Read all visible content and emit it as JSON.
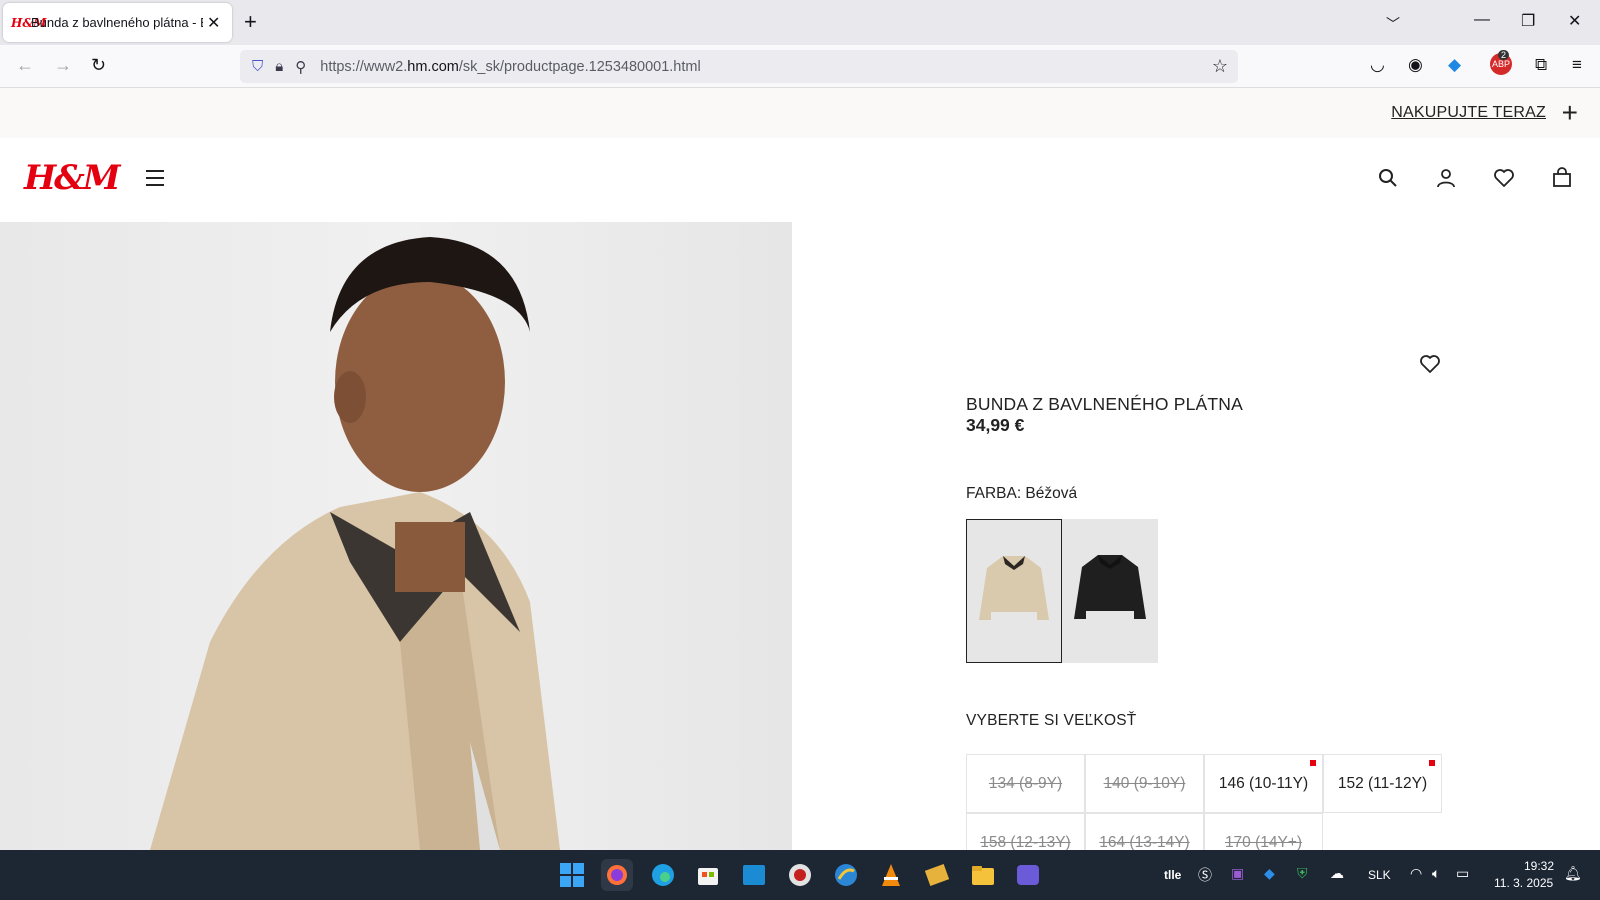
{
  "browser": {
    "tab_title": "Bunda z bavlneného plátna - Be",
    "tab_favicon": "H&M",
    "url_prefix": "https://www2.",
    "url_domain": "hm.com",
    "url_path": "/sk_sk/productpage.1253480001.html",
    "extension_count": "2"
  },
  "promo": {
    "link_label": "NAKUPUJTE TERAZ"
  },
  "header": {
    "logo": "H&M"
  },
  "product": {
    "title": "BUNDA Z BAVLNENÉHO PLÁTNA",
    "price": "34,99 €",
    "color_label": "FARBA: Béžová",
    "swatches": [
      {
        "name": "beige",
        "color": "#d9c9ad",
        "collar": "#2b2622"
      },
      {
        "name": "black",
        "color": "#1f1f1f",
        "collar": "#121212"
      }
    ],
    "size_label": "VYBERTE SI VEĽKOSŤ",
    "sizes": [
      {
        "label": "134 (8-9Y)",
        "available": false,
        "low_stock": false
      },
      {
        "label": "140 (9-10Y)",
        "available": false,
        "low_stock": false
      },
      {
        "label": "146 (10-11Y)",
        "available": true,
        "low_stock": true
      },
      {
        "label": "152 (11-12Y)",
        "available": true,
        "low_stock": true
      },
      {
        "label": "158 (12-13Y)",
        "available": false,
        "low_stock": false
      },
      {
        "label": "164 (13-14Y)",
        "available": false,
        "low_stock": false
      },
      {
        "label": "170 (14Y+)",
        "available": false,
        "low_stock": false
      }
    ]
  },
  "taskbar": {
    "tray_lang": "SLK",
    "tray_text": "tlle",
    "time": "19:32",
    "date": "11. 3. 2025"
  },
  "colors": {
    "brand_red": "#e50010",
    "taskbar_bg": "#1d2633"
  }
}
